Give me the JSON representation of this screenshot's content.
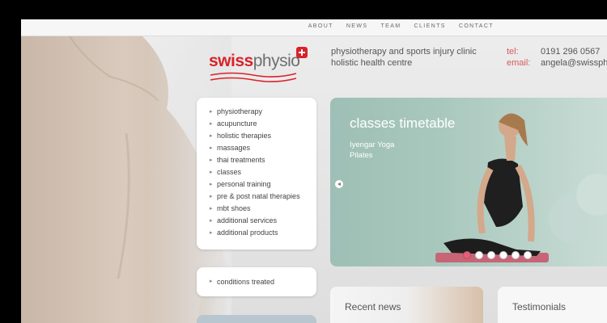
{
  "nav": {
    "items": [
      "ABOUT",
      "NEWS",
      "TEAM",
      "CLIENTS",
      "CONTACT"
    ]
  },
  "logo": {
    "swiss": "swiss",
    "physio": "physio"
  },
  "tagline": {
    "line1": "physiotherapy and sports injury clinic",
    "line2": "holistic health centre"
  },
  "contact": {
    "tel_label": "tel:",
    "tel_value": "0191 296 0567",
    "email_label": "email:",
    "email_value": "angela@swissphysio"
  },
  "menu": {
    "items": [
      "physiotherapy",
      "acupuncture",
      "holistic therapies",
      "massages",
      "thai treatments",
      "classes",
      "personal training",
      "pre & post natal therapies",
      "mbt shoes",
      "additional services",
      "additional products"
    ]
  },
  "conditions": {
    "label": "conditions treated"
  },
  "slider": {
    "title": "classes timetable",
    "subtitle_line1": "Iyengar Yoga",
    "subtitle_line2": "Pilates",
    "dot_count": 6,
    "active_dot": 0
  },
  "news": {
    "title": "Recent news"
  },
  "testimonials": {
    "title": "Testimonials"
  },
  "colors": {
    "brand_red": "#d8232a",
    "slider_teal": "#a9c8bd",
    "active_dot": "#e0607a"
  }
}
